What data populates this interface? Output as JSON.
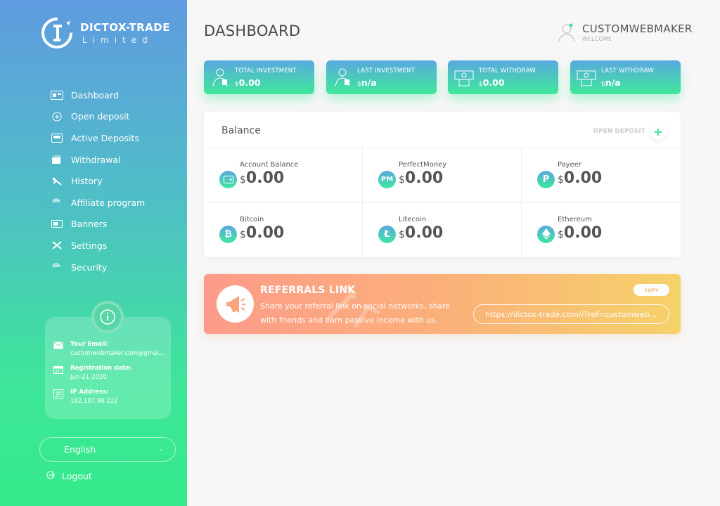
{
  "brand": {
    "name": "DICTOX-TRADE",
    "sub": "Limited"
  },
  "sidebar": {
    "items": [
      {
        "label": "Dashboard",
        "icon": "dashboard-icon"
      },
      {
        "label": "Open deposit",
        "icon": "plus-circle-icon"
      },
      {
        "label": "Active Deposits",
        "icon": "deposits-icon"
      },
      {
        "label": "Withdrawal",
        "icon": "wallet-icon"
      },
      {
        "label": "History",
        "icon": "history-icon"
      },
      {
        "label": "Affiliate program",
        "icon": "affiliate-icon"
      },
      {
        "label": "Banners",
        "icon": "banners-icon"
      },
      {
        "label": "Settings",
        "icon": "settings-icon"
      },
      {
        "label": "Security",
        "icon": "security-icon"
      }
    ],
    "info": {
      "email_label": "Your Email:",
      "email": "customwebmaker.com@gmai...",
      "reg_label": "Registration date:",
      "reg": "Jun-21-2020",
      "ip_label": "IP Address:",
      "ip": "182.187.98.222"
    },
    "language": "English",
    "logout": "Logout"
  },
  "header": {
    "title": "DASHBOARD",
    "username": "CUSTOMWEBMAKER",
    "welcome": "WELCOME"
  },
  "stats": [
    {
      "label": "TOTAL INVESTMENT",
      "currency": "$",
      "value": "0.00"
    },
    {
      "label": "LAST INVESTMENT",
      "currency": "$",
      "value": "n/a"
    },
    {
      "label": "TOTAL WITHDRAW",
      "currency": "$",
      "value": "0.00"
    },
    {
      "label": "LAST WITHDRAW",
      "currency": "$",
      "value": "n/a"
    }
  ],
  "balance": {
    "title": "Balance",
    "open_deposit": "OPEN DEPOSIT",
    "cells": [
      {
        "name": "Account Balance",
        "currency": "$",
        "value": "0.00",
        "glyph": ""
      },
      {
        "name": "PerfectMoney",
        "currency": "$",
        "value": "0.00",
        "glyph": "PM"
      },
      {
        "name": "Payeer",
        "currency": "$",
        "value": "0.00",
        "glyph": "P"
      },
      {
        "name": "Bitcoin",
        "currency": "$",
        "value": "0.00",
        "glyph": "₿"
      },
      {
        "name": "Litecoin",
        "currency": "$",
        "value": "0.00",
        "glyph": "Ł"
      },
      {
        "name": "Ethereum",
        "currency": "$",
        "value": "0.00",
        "glyph": ""
      }
    ]
  },
  "referral": {
    "title": "REFERRALS LINK",
    "desc": "Share your referral link on social networks, share with friends and earn passive income with us.",
    "copy": "COPY",
    "link": "https://dictox-trade.com//?ref=customweb..."
  },
  "colors": {
    "accent_top": "#5aa8e0",
    "accent_bottom": "#3ee89a",
    "ref_start": "#fd9b8a",
    "ref_end": "#f6d26a"
  }
}
